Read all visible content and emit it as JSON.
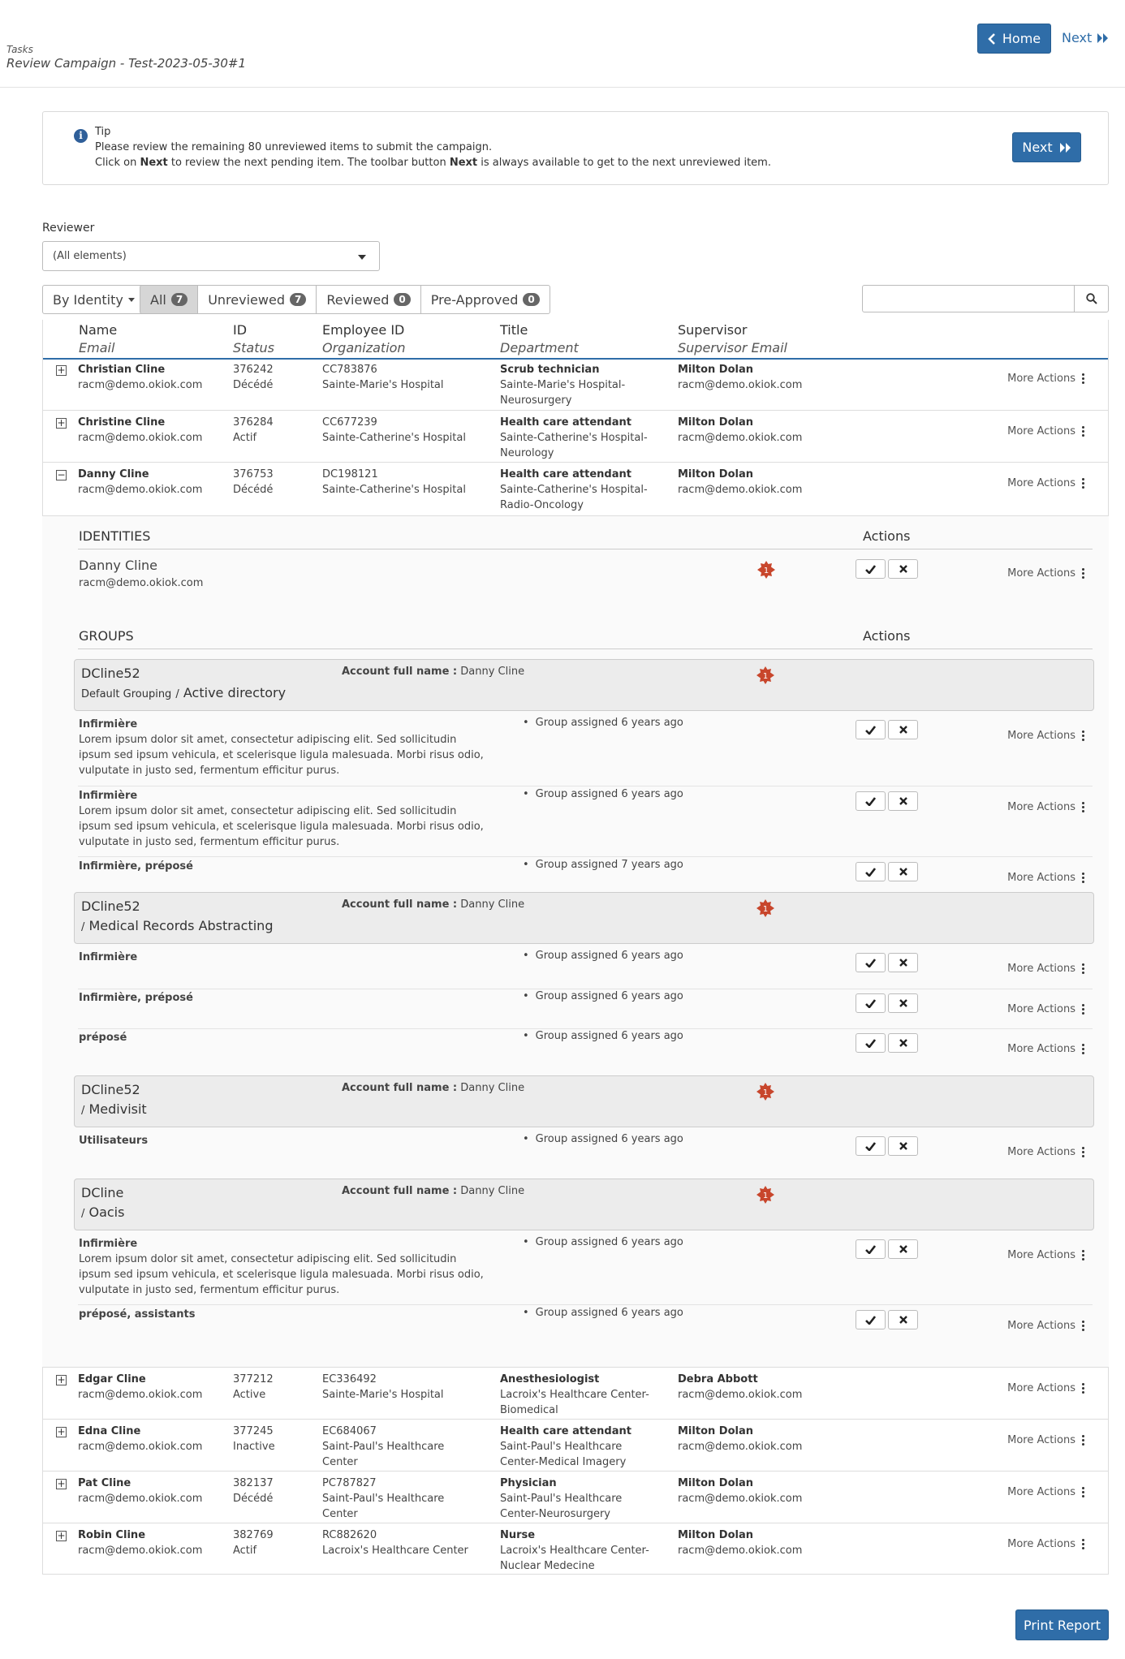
{
  "header": {
    "breadcrumb": "Tasks",
    "title": "Review Campaign - Test-2023-05-30#1",
    "home_label": "Home",
    "next_label": "Next"
  },
  "tip": {
    "title": "Tip",
    "line1": "Please review the remaining 80 unreviewed items to submit the campaign.",
    "line2_a": "Click on ",
    "line2_b": "Next",
    "line2_c": " to review the next pending item. The toolbar button ",
    "line2_d": "Next",
    "line2_e": " is always available to get to the next unreviewed item.",
    "next_label": "Next"
  },
  "reviewer": {
    "label": "Reviewer",
    "value": "(All elements)"
  },
  "filters": {
    "by_identity": "By Identity",
    "all": "All",
    "all_count": "7",
    "unreviewed": "Unreviewed",
    "unreviewed_count": "7",
    "reviewed": "Reviewed",
    "reviewed_count": "0",
    "preapproved": "Pre-Approved",
    "preapproved_count": "0"
  },
  "columns": {
    "name": "Name",
    "email": "Email",
    "id": "ID",
    "status": "Status",
    "employee_id": "Employee ID",
    "organization": "Organization",
    "title": "Title",
    "department": "Department",
    "supervisor": "Supervisor",
    "supervisor_email": "Supervisor Email"
  },
  "more_actions": "More Actions",
  "rows": [
    {
      "name": "Christian Cline",
      "email": "racm@demo.okiok.com",
      "id": "376242",
      "status": "Décédé",
      "emp": "CC783876",
      "org": "Sainte-Marie's Hospital",
      "org2": "",
      "title": "Scrub technician",
      "dept1": "Sainte-Marie's Hospital-",
      "dept2": "Neurosurgery",
      "sup": "Milton Dolan",
      "sup_email": "racm@demo.okiok.com",
      "expand": "+"
    },
    {
      "name": "Christine Cline",
      "email": "racm@demo.okiok.com",
      "id": "376284",
      "status": "Actif",
      "emp": "CC677239",
      "org": "Sainte-Catherine's Hospital",
      "org2": "",
      "title": "Health care attendant",
      "dept1": "Sainte-Catherine's Hospital-",
      "dept2": "Neurology",
      "sup": "Milton Dolan",
      "sup_email": "racm@demo.okiok.com",
      "expand": "+"
    },
    {
      "name": "Danny Cline",
      "email": "racm@demo.okiok.com",
      "id": "376753",
      "status": "Décédé",
      "emp": "DC198121",
      "org": "Sainte-Catherine's Hospital",
      "org2": "",
      "title": "Health care attendant",
      "dept1": "Sainte-Catherine's Hospital-",
      "dept2": "Radio-Oncology",
      "sup": "Milton Dolan",
      "sup_email": "racm@demo.okiok.com",
      "expand": "−"
    },
    {
      "name": "Edgar Cline",
      "email": "racm@demo.okiok.com",
      "id": "377212",
      "status": "Active",
      "emp": "EC336492",
      "org": "Sainte-Marie's Hospital",
      "org2": "",
      "title": "Anesthesiologist",
      "dept1": "Lacroix's Healthcare Center-",
      "dept2": "Biomedical",
      "sup": "Debra Abbott",
      "sup_email": "racm@demo.okiok.com",
      "expand": "+"
    },
    {
      "name": "Edna Cline",
      "email": "racm@demo.okiok.com",
      "id": "377245",
      "status": "Inactive",
      "emp": "EC684067",
      "org": "Saint-Paul's Healthcare",
      "org2": "Center",
      "title": "Health care attendant",
      "dept1": "Saint-Paul's Healthcare",
      "dept2": "Center-Medical Imagery",
      "sup": "Milton Dolan",
      "sup_email": "racm@demo.okiok.com",
      "expand": "+"
    },
    {
      "name": "Pat Cline",
      "email": "racm@demo.okiok.com",
      "id": "382137",
      "status": "Décédé",
      "emp": "PC787827",
      "org": "Saint-Paul's Healthcare",
      "org2": "Center",
      "title": "Physician",
      "dept1": "Saint-Paul's Healthcare",
      "dept2": "Center-Neurosurgery",
      "sup": "Milton Dolan",
      "sup_email": "racm@demo.okiok.com",
      "expand": "+"
    },
    {
      "name": "Robin Cline",
      "email": "racm@demo.okiok.com",
      "id": "382769",
      "status": "Actif",
      "emp": "RC882620",
      "org": "Lacroix's Healthcare Center",
      "org2": "",
      "title": "Nurse",
      "dept1": "Lacroix's Healthcare Center-",
      "dept2": "Nuclear Medecine",
      "sup": "Milton Dolan",
      "sup_email": "racm@demo.okiok.com",
      "expand": "+"
    }
  ],
  "detail": {
    "identities_title": "IDENTITIES",
    "actions_title": "Actions",
    "groups_title": "GROUPS",
    "identity_name": "Danny Cline",
    "identity_email": "racm@demo.okiok.com",
    "alert_count": "1",
    "account_label": "Account full name :",
    "account_value": "Danny Cline",
    "lorem1": "Lorem ipsum dolor sit amet, consectetur adipiscing elit. Sed sollicitudin",
    "lorem2": "ipsum sed ipsum vehicula, et scelerisque ligula malesuada. Morbi risus odio,",
    "lorem3": "vulputate in justo sed, fermentum efficitur purus.",
    "groups": [
      {
        "name": "DCline52",
        "prefix": "Default Grouping",
        "sep": "/",
        "system": "Active directory"
      },
      {
        "name": "DCline52",
        "prefix": "",
        "sep": "/",
        "system": "Medical Records Abstracting"
      },
      {
        "name": "DCline52",
        "prefix": "",
        "sep": "/",
        "system": "Medivisit"
      },
      {
        "name": "DCline",
        "prefix": "",
        "sep": "/",
        "system": "Oacis"
      }
    ],
    "items": [
      {
        "name": "Infirmière",
        "assigned": "Group assigned 6 years ago"
      },
      {
        "name": "Infirmière",
        "assigned": "Group assigned 6 years ago"
      },
      {
        "name": "Infirmière, préposé",
        "assigned": "Group assigned 7 years ago"
      },
      {
        "name": "Infirmière",
        "assigned": "Group assigned 6 years ago"
      },
      {
        "name": "Infirmière, préposé",
        "assigned": "Group assigned 6 years ago"
      },
      {
        "name": "préposé",
        "assigned": "Group assigned 6 years ago"
      },
      {
        "name": "Utilisateurs",
        "assigned": "Group assigned 6 years ago"
      },
      {
        "name": "Infirmière",
        "assigned": "Group assigned 6 years ago"
      },
      {
        "name": "préposé, assistants",
        "assigned": "Group assigned 6 years ago"
      }
    ]
  },
  "print_label": "Print Report",
  "colors": {
    "primary": "#2f6da8",
    "link": "#3572b0",
    "alert": "#c8462c"
  }
}
